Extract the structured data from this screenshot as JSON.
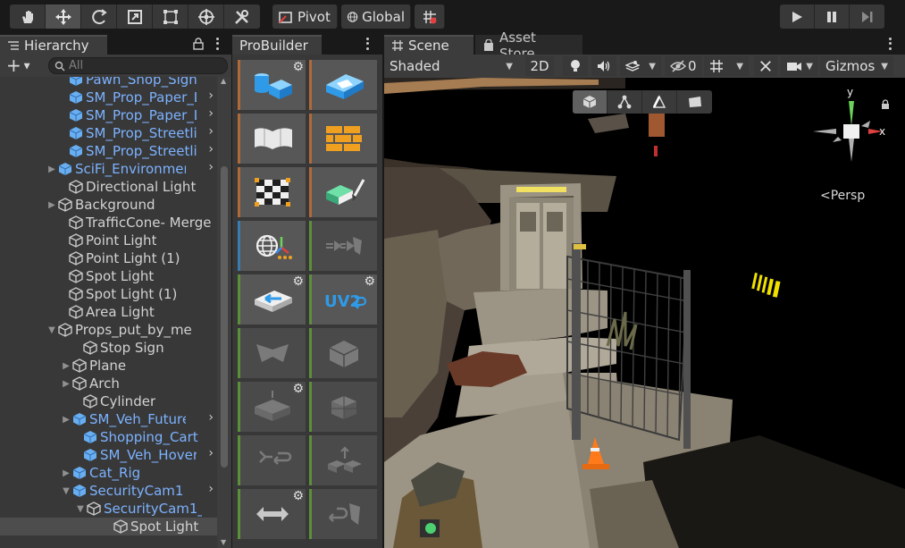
{
  "toolbar": {
    "tools": [
      "hand-tool",
      "move-tool",
      "rotate-tool",
      "scale-tool",
      "rect-tool",
      "transform-tool",
      "custom-tool"
    ],
    "pivot_label": "Pivot",
    "global_label": "Global",
    "snap": "grid-snap"
  },
  "hierarchy": {
    "tab_label": "Hierarchy",
    "search_placeholder": "All",
    "rows": [
      {
        "label": "Pawn_Shop_Sign",
        "prefab": true
      },
      {
        "label": "SM_Prop_Paper_L",
        "prefab": true
      },
      {
        "label": "SM_Prop_Paper_L",
        "prefab": true
      },
      {
        "label": "SM_Prop_Streetlig",
        "prefab": true
      },
      {
        "label": "SM_Prop_Streetlig",
        "prefab": true
      },
      {
        "label": "SciFi_Environmer",
        "prefab": true
      },
      {
        "label": "Directional Light",
        "prefab": false
      },
      {
        "label": "Background",
        "prefab": false
      },
      {
        "label": "TrafficCone- Merge",
        "prefab": false
      },
      {
        "label": "Point Light",
        "prefab": false
      },
      {
        "label": "Point Light (1)",
        "prefab": false
      },
      {
        "label": "Spot Light",
        "prefab": false
      },
      {
        "label": "Spot Light (1)",
        "prefab": false
      },
      {
        "label": "Area Light",
        "prefab": false
      },
      {
        "label": "Props_put_by_me",
        "prefab": false
      },
      {
        "label": "Stop Sign",
        "prefab": false
      },
      {
        "label": "Plane",
        "prefab": false
      },
      {
        "label": "Arch",
        "prefab": false
      },
      {
        "label": "Cylinder",
        "prefab": false
      },
      {
        "label": "SM_Veh_Future",
        "prefab": true
      },
      {
        "label": "Shopping_Cart",
        "prefab": true
      },
      {
        "label": "SM_Veh_Hover",
        "prefab": true
      },
      {
        "label": "Cat_Rig",
        "prefab": true
      },
      {
        "label": "SecurityCam1",
        "prefab": true
      },
      {
        "label": "SecurityCam1_",
        "prefab": true
      },
      {
        "label": "Spot Light",
        "prefab": false
      }
    ]
  },
  "probuilder": {
    "tab_label": "ProBuilder",
    "uv2_label": "UV2"
  },
  "scene": {
    "tab_label": "Scene",
    "asset_store_label": "Asset Store",
    "shading_mode": "Shaded",
    "mode_2d": "2D",
    "hidden_count": "0",
    "gizmos_label": "Gizmos",
    "persp_label": "Persp",
    "axis_x": "x",
    "axis_y": "y"
  }
}
